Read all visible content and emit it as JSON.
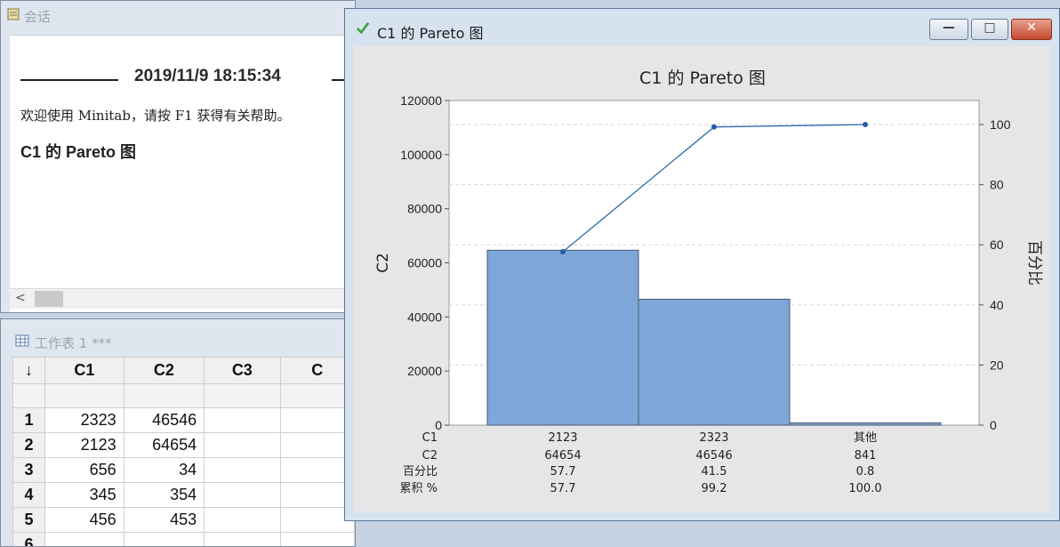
{
  "session": {
    "title": "会话",
    "timestamp": "2019/11/9 18:15:34",
    "welcome": "欢迎使用 Minitab，请按 F1 获得有关帮助。",
    "heading": "C1 的 Pareto 图",
    "scroll_left": "<"
  },
  "worksheet": {
    "title": "工作表 1 ***",
    "corner": "↓",
    "columns": [
      "C1",
      "C2",
      "C3",
      "C"
    ],
    "rows": [
      {
        "num": "1",
        "c1": "2323",
        "c2": "46546"
      },
      {
        "num": "2",
        "c1": "2123",
        "c2": "64654"
      },
      {
        "num": "3",
        "c1": "656",
        "c2": "34"
      },
      {
        "num": "4",
        "c1": "345",
        "c2": "354"
      },
      {
        "num": "5",
        "c1": "456",
        "c2": "453"
      },
      {
        "num": "6",
        "c1": "",
        "c2": ""
      }
    ]
  },
  "graph_window": {
    "title": "C1 的 Pareto 图",
    "minimize": "—",
    "maximize": "□",
    "close": "✕"
  },
  "colors": {
    "bar_fill": "#7ea6d8",
    "bar_stroke": "#4a5a70",
    "line": "#1f5fa8",
    "plot_bg": "#ffffff",
    "frame_bg": "#e6e6e6"
  },
  "chart_data": {
    "type": "bar",
    "title": "C1 的 Pareto 图",
    "ylabel": "C2",
    "y2label": "百分比",
    "ylim": [
      0,
      120000
    ],
    "y2lim": [
      0,
      108
    ],
    "yticks": [
      0,
      20000,
      40000,
      60000,
      80000,
      100000,
      120000
    ],
    "y2ticks": [
      0,
      20,
      40,
      60,
      80,
      100
    ],
    "grid": "dashed horizontal at secondary-axis ticks",
    "categories": [
      "2123",
      "2323",
      "其他"
    ],
    "values": [
      64654,
      46546,
      841
    ],
    "cumulative_percent": [
      57.7,
      99.2,
      100.0
    ],
    "table": {
      "row_labels": [
        "C1",
        "C2",
        "百分比",
        "累积 %"
      ],
      "rows": [
        [
          "2123",
          "2323",
          "其他"
        ],
        [
          "64654",
          "46546",
          "841"
        ],
        [
          "57.7",
          "41.5",
          "0.8"
        ],
        [
          "57.7",
          "99.2",
          "100.0"
        ]
      ]
    }
  }
}
